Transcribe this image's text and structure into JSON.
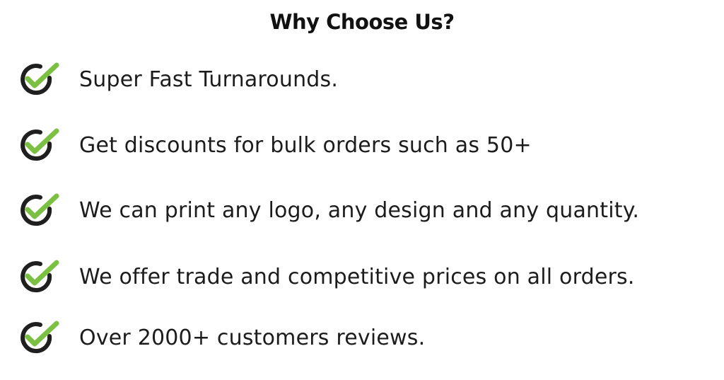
{
  "heading": "Why Choose Us?",
  "items": [
    {
      "label": "Super Fast Turnarounds.",
      "icon": "check-circle-icon"
    },
    {
      "label": "Get discounts for bulk orders such as 50+",
      "icon": "check-circle-icon"
    },
    {
      "label": "We can print any logo, any design and any quantity.",
      "icon": "check-circle-icon"
    },
    {
      "label": "We offer trade and competitive prices on all orders.",
      "icon": "check-circle-icon"
    },
    {
      "label": "Over 2000+ customers reviews.",
      "icon": "check-circle-icon"
    }
  ],
  "colors": {
    "check_green": "#7bc043",
    "circle_dark": "#1f1f1f",
    "text": "#1c1c1c"
  }
}
